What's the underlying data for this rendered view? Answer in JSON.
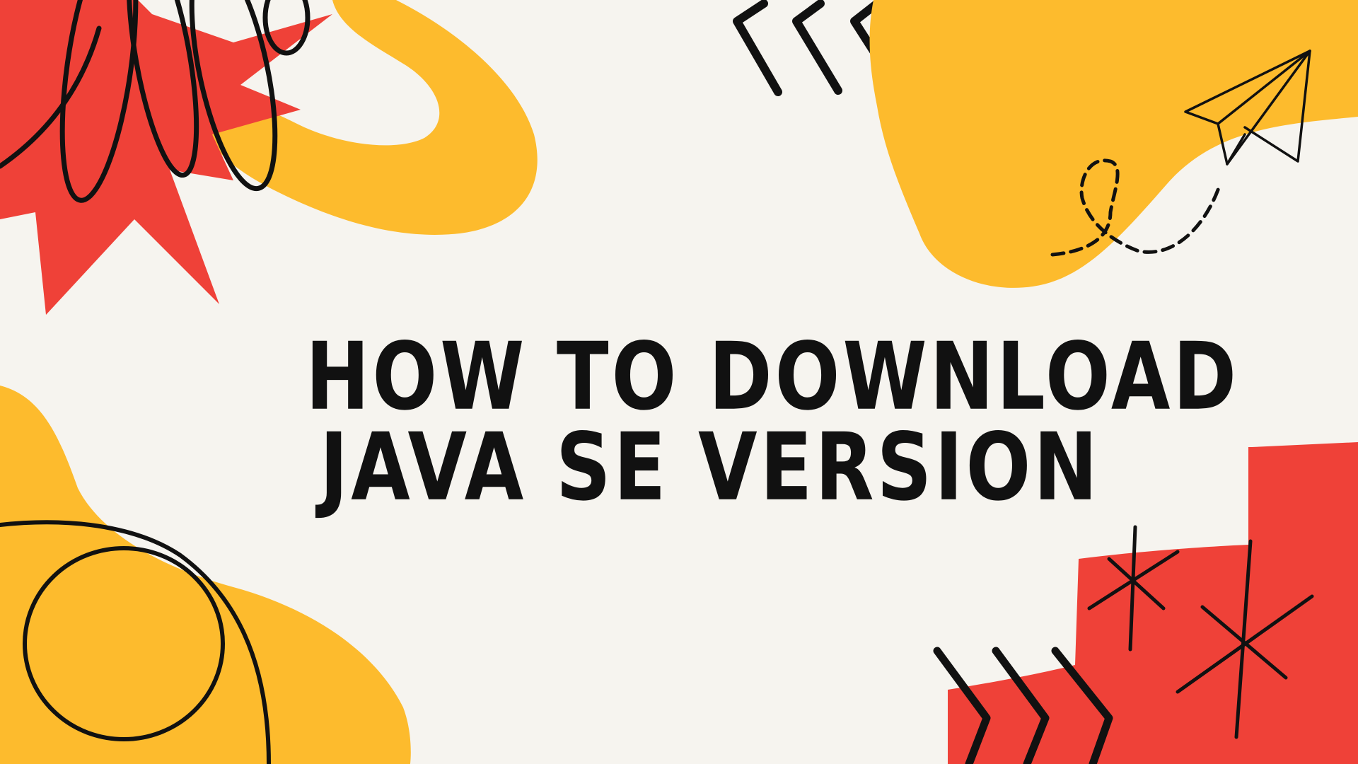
{
  "title": {
    "line1": "HOW TO DOWNLOAD",
    "line2": "JAVA SE VERSION"
  },
  "colors": {
    "background": "#f6f4ef",
    "yellow": "#fdbb2d",
    "red": "#ef4138",
    "ink": "#111111"
  },
  "decorations": [
    "red-starburst-icon",
    "yellow-swirl-blob",
    "scribble-loops-icon",
    "chevrons-left-icon",
    "paper-plane-icon",
    "dashed-loop-trail-icon",
    "yellow-blob-bottom-left",
    "circle-scribble-icon",
    "red-square-blob",
    "chevrons-right-icon",
    "sparkle-star-icon"
  ]
}
